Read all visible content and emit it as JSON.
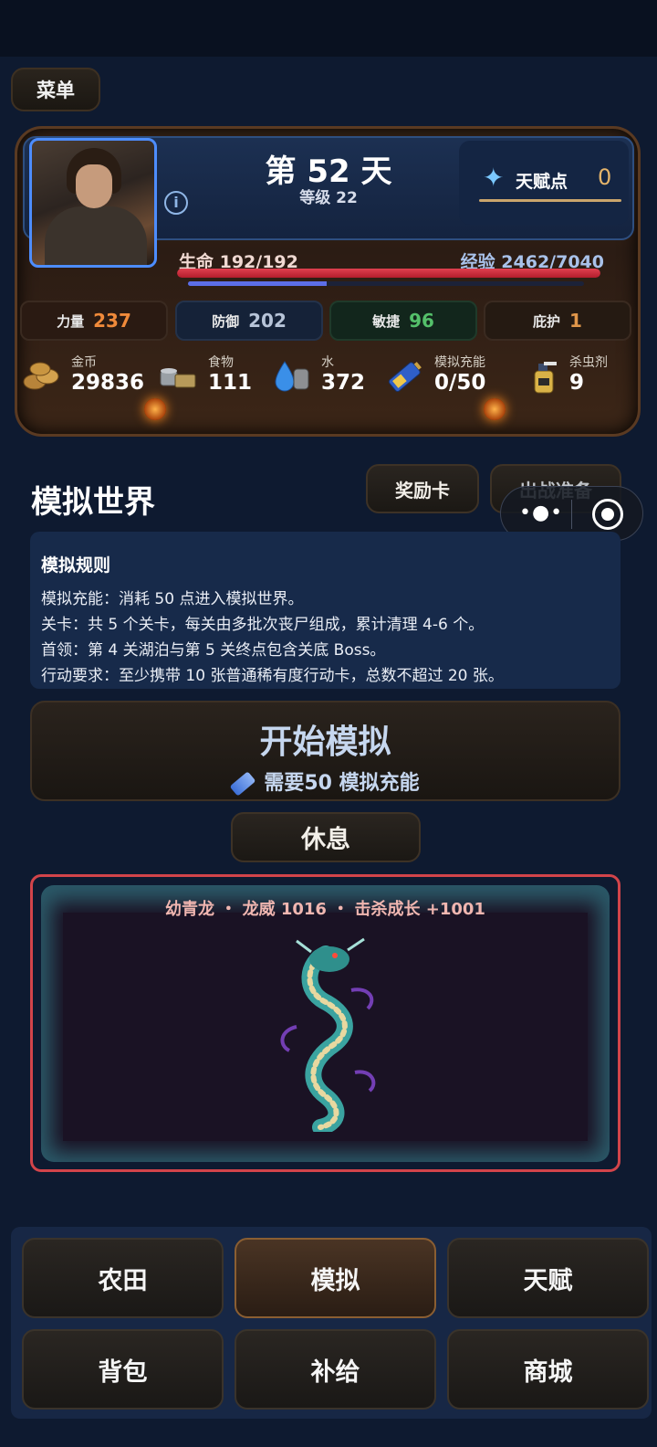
{
  "top_menu": {
    "menu_label": "菜单"
  },
  "player": {
    "day_title": "第 52 天",
    "level": "等级 22",
    "talent_label": "天赋点",
    "talent_value": "0",
    "hp_text": "生命 192/192",
    "hp_fraction": 1.0,
    "exp_text": "经验 2462/7040",
    "exp_fraction": 0.35
  },
  "stats": [
    {
      "label": "力量",
      "value": "237",
      "color": "#f08a3a"
    },
    {
      "label": "防御",
      "value": "202",
      "color": "#b7c4d8"
    },
    {
      "label": "敏捷",
      "value": "96",
      "color": "#54c06a"
    },
    {
      "label": "庇护",
      "value": "1",
      "color": "#e0964a"
    }
  ],
  "resources": [
    {
      "label": "金币",
      "value": "29836",
      "icon": "coins-icon"
    },
    {
      "label": "食物",
      "value": "111",
      "icon": "food-cans-icon"
    },
    {
      "label": "水",
      "value": "372",
      "icon": "water-drop-icon"
    },
    {
      "label": "模拟充能",
      "value": "0/50",
      "icon": "battery-icon"
    },
    {
      "label": "杀虫剂",
      "value": "9",
      "icon": "spray-bottle-icon"
    }
  ],
  "section": {
    "title": "模拟世界",
    "reward_button": "奖励卡",
    "prep_button": "出战准备"
  },
  "rules": {
    "title": "模拟规则",
    "lines": [
      "模拟充能：消耗 50 点进入模拟世界。",
      "关卡：共 5 个关卡，每关由多批次丧尸组成，累计清理 4-6 个。",
      "首领：第 4 关湖泊与第 5 关终点包含关底 Boss。",
      "行动要求：至少携带 10 张普通稀有度行动卡，总数不超过 20 张。"
    ]
  },
  "start": {
    "title": "开始模拟",
    "requirement": "需要50 模拟充能"
  },
  "rest_button": "休息",
  "dragon": {
    "caption": "幼青龙 ・ 龙威 1016 ・ 击杀成长 +1001"
  },
  "nav": [
    {
      "label": "农田",
      "active": false
    },
    {
      "label": "模拟",
      "active": true
    },
    {
      "label": "天赋",
      "active": false
    },
    {
      "label": "背包",
      "active": false
    },
    {
      "label": "补给",
      "active": false
    },
    {
      "label": "商城",
      "active": false
    }
  ]
}
